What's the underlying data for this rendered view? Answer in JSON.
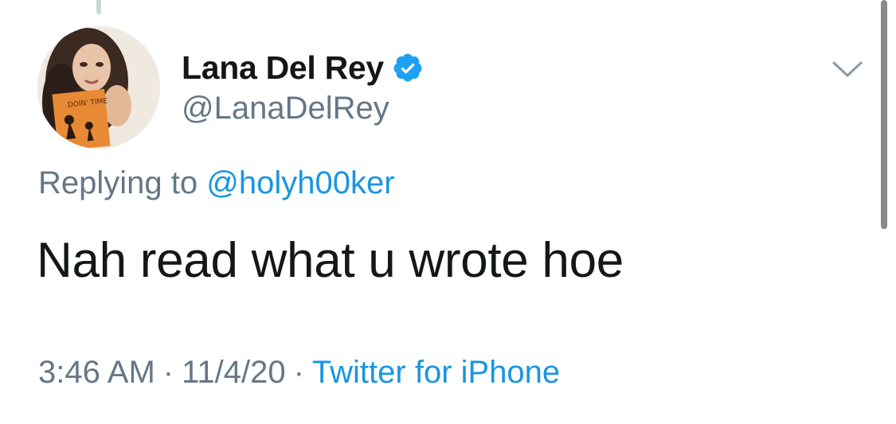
{
  "tweet": {
    "author": {
      "display_name": "Lana Del Rey",
      "handle": "@LanaDelRey",
      "verified_icon": "verified-badge-icon",
      "avatar_book_text": "DOIN' TIME"
    },
    "replying": {
      "prefix": "Replying to",
      "mention": "@holyh00ker"
    },
    "text": "Nah read what u wrote hoe",
    "meta": {
      "time": "3:46 AM",
      "separator": "·",
      "date": "11/4/20",
      "source": "Twitter for iPhone"
    },
    "menu_icon": "chevron-down-icon"
  },
  "colors": {
    "text": "#14171a",
    "secondary": "#657786",
    "link": "#1b95e0",
    "verified": "#1da1f2"
  }
}
